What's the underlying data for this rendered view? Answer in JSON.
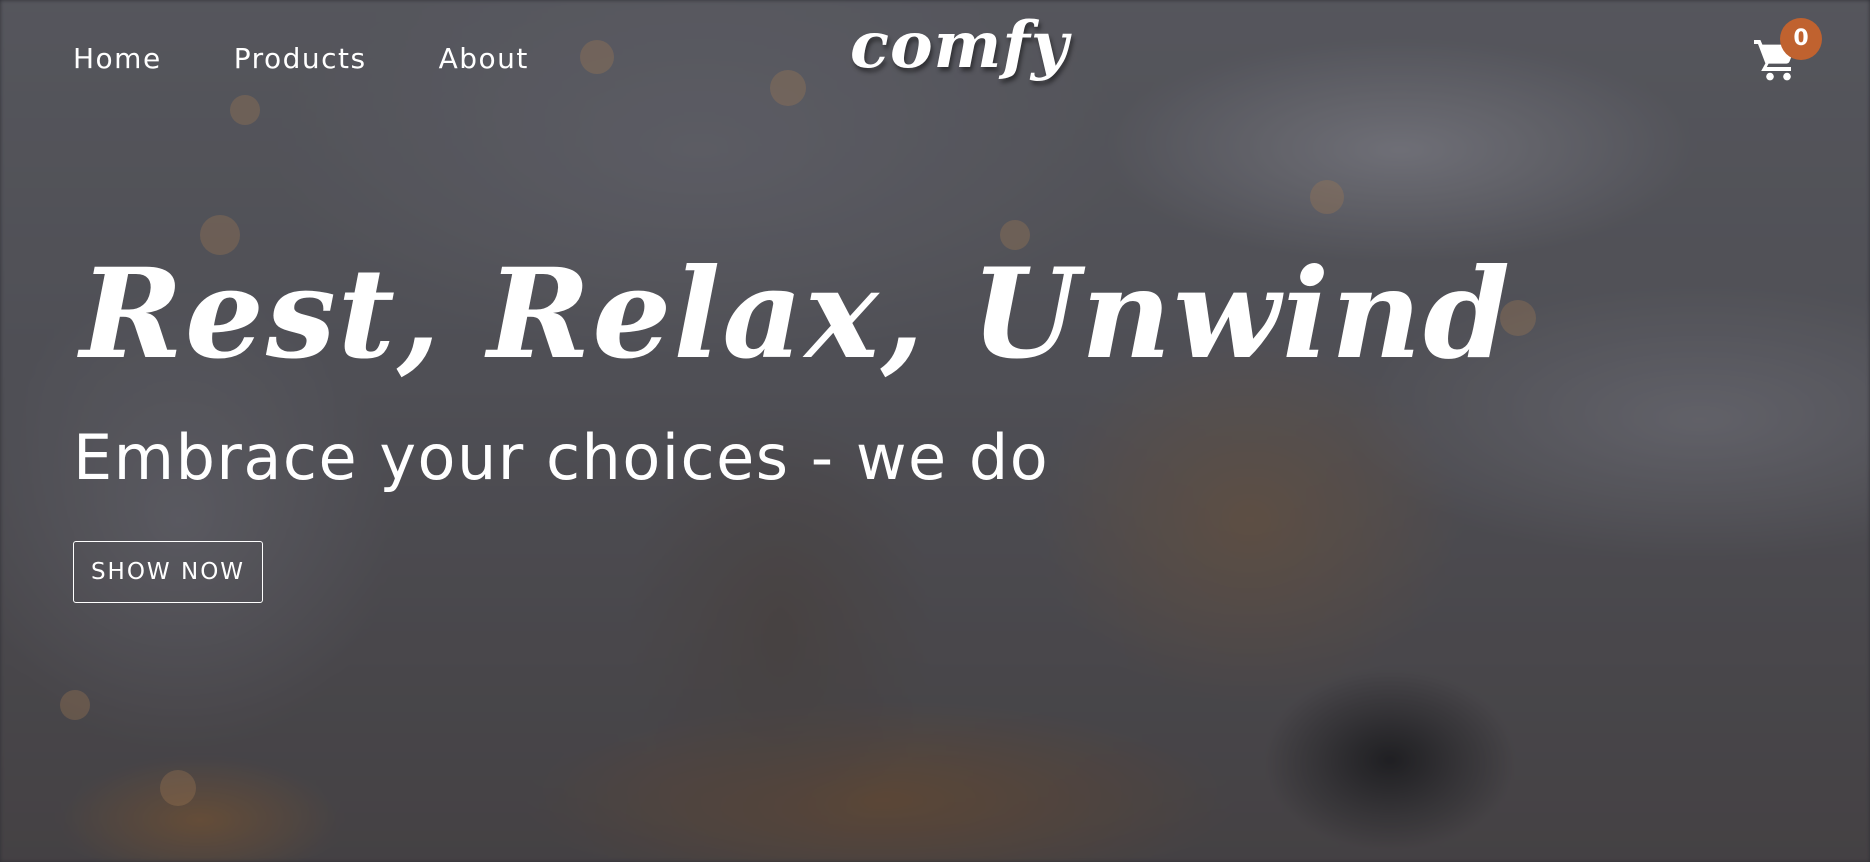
{
  "nav": {
    "links": [
      "Home",
      "Products",
      "About"
    ],
    "logo": "comfy",
    "cart_count": "0"
  },
  "hero": {
    "title": "Rest, Relax, Unwind",
    "subtitle": "Embrace your choices - we do",
    "cta_label": "SHOW NOW",
    "background_image": "blurred cozy scene with mug, camera and fairy lights"
  },
  "colors": {
    "badge": "#c0622f",
    "text": "#ffffff"
  },
  "icons": [
    "shopping-cart-icon"
  ]
}
